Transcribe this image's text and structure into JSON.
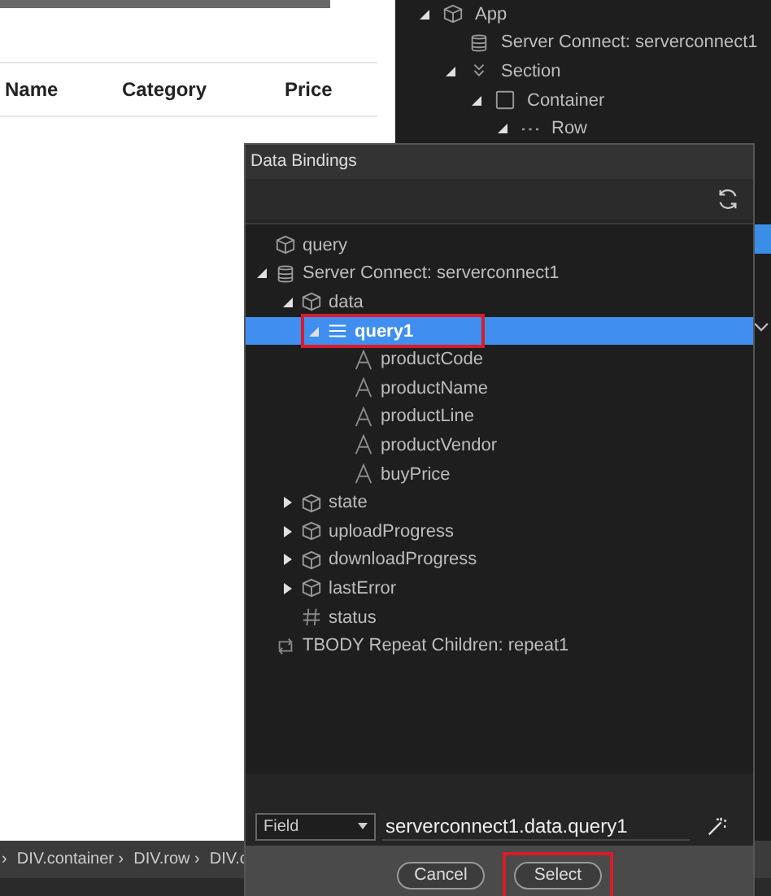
{
  "page": {
    "columns": [
      "Name",
      "Category",
      "Price"
    ]
  },
  "outline": [
    {
      "label": "App",
      "kind": "object",
      "expanded": true,
      "children": [
        {
          "label": "Server Connect: serverconnect1",
          "kind": "database"
        },
        {
          "label": "Section",
          "kind": "section",
          "expanded": true,
          "children": [
            {
              "label": "Container",
              "kind": "container",
              "expanded": true,
              "children": [
                {
                  "label": "Row",
                  "kind": "row",
                  "expanded": true
                }
              ]
            }
          ]
        }
      ]
    }
  ],
  "breadcrumb": [
    "›",
    "DIV.container ›",
    "DIV.row ›",
    "DIV.c"
  ],
  "dialog": {
    "title": "Data Bindings",
    "tree": [
      {
        "label": "query",
        "kind": "object",
        "selected": false
      },
      {
        "label": "Server Connect: serverconnect1",
        "kind": "database",
        "expanded": true,
        "selected": false,
        "children": [
          {
            "label": "data",
            "kind": "object",
            "expanded": true,
            "selected": false,
            "children": [
              {
                "label": "query1",
                "kind": "list",
                "expanded": true,
                "selected": true,
                "highlighted": true,
                "children": [
                  {
                    "label": "productCode",
                    "kind": "text",
                    "selected": false
                  },
                  {
                    "label": "productName",
                    "kind": "text",
                    "selected": false
                  },
                  {
                    "label": "productLine",
                    "kind": "text",
                    "selected": false
                  },
                  {
                    "label": "productVendor",
                    "kind": "text",
                    "selected": false
                  },
                  {
                    "label": "buyPrice",
                    "kind": "text",
                    "selected": false
                  }
                ]
              }
            ]
          },
          {
            "label": "state",
            "kind": "object",
            "expanded": false,
            "selected": false
          },
          {
            "label": "uploadProgress",
            "kind": "object",
            "expanded": false,
            "selected": false
          },
          {
            "label": "downloadProgress",
            "kind": "object",
            "expanded": false,
            "selected": false
          },
          {
            "label": "lastError",
            "kind": "object",
            "expanded": false,
            "selected": false
          },
          {
            "label": "status",
            "kind": "number",
            "selected": false
          }
        ]
      },
      {
        "label": "TBODY Repeat Children: repeat1",
        "kind": "repeat",
        "selected": false
      }
    ],
    "field": {
      "type": "Field",
      "value": "serverconnect1.data.query1"
    },
    "buttons": [
      {
        "label": "Cancel",
        "highlighted": false
      },
      {
        "label": "Select",
        "highlighted": true
      }
    ]
  }
}
